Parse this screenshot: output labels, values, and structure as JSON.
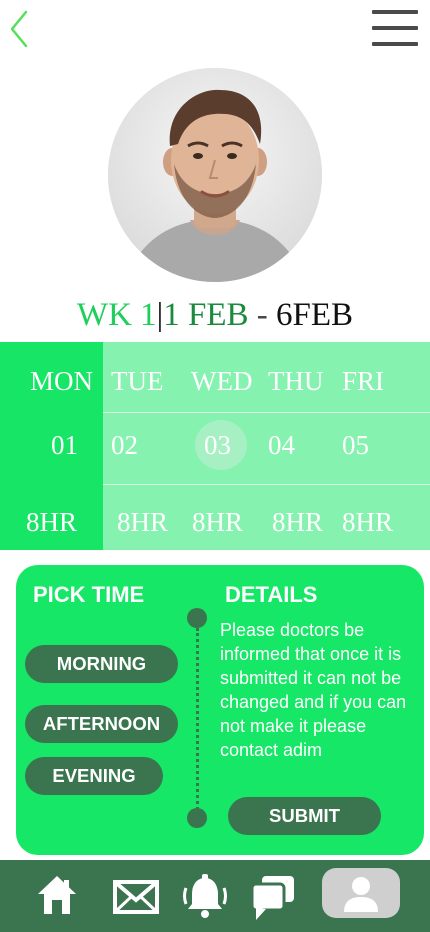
{
  "header": {
    "back_icon": "chevron-left-icon",
    "menu_icon": "hamburger-menu-icon"
  },
  "profile": {
    "avatar": "user-photo"
  },
  "week": {
    "prefix": "WK 1",
    "start": "1 FEB",
    "separator": "-",
    "end": "6FEB"
  },
  "calendar": {
    "days": [
      "MON",
      "TUE",
      "WED",
      "THU",
      "FRI"
    ],
    "dates": [
      "01",
      "02",
      "03",
      "04",
      "05"
    ],
    "hours": [
      "8HR",
      "8HR",
      "8HR",
      "8HR",
      "8HR"
    ],
    "selected_date": "03"
  },
  "pick_time": {
    "title": "PICK TIME",
    "options": [
      "MORNING",
      "AFTERNOON",
      "EVENING"
    ]
  },
  "details": {
    "title": "DETAILS",
    "text": "Please doctors be informed that once it is submitted it can not be changed and if you can not make it  please contact adim",
    "submit_label": "SUBMIT"
  },
  "nav": {
    "items": [
      "home-icon",
      "mail-icon",
      "bell-icon",
      "chat-icon",
      "profile-icon"
    ]
  },
  "colors": {
    "accent": "#16e766",
    "accent_light": "#86f2b0",
    "dark_green": "#3a7550",
    "back_chevron": "#55e05a"
  }
}
